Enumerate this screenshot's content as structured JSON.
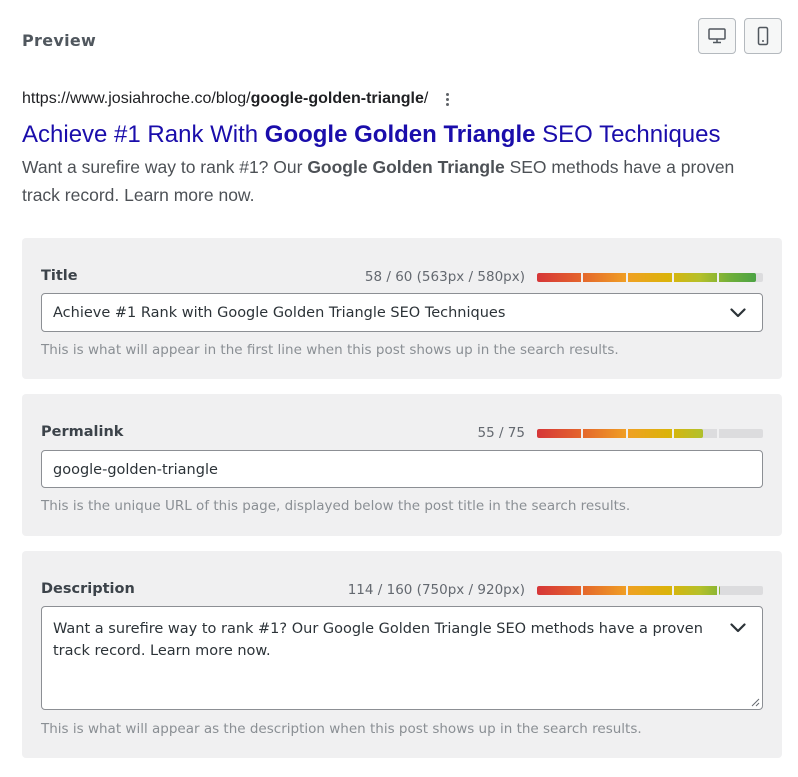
{
  "preview": {
    "heading": "Preview",
    "desktop_icon": "desktop-icon",
    "mobile_icon": "mobile-icon"
  },
  "serp": {
    "url_prefix": "https://www.josiahroche.co/blog/",
    "url_slug": "google-golden-triangle",
    "url_suffix": "/",
    "menu_icon": "more-vertical-icon",
    "title_before": "Achieve #1 Rank With ",
    "title_bold": "Google Golden Triangle",
    "title_after": " SEO Techniques",
    "desc_before": "Want a surefire way to rank #1? Our ",
    "desc_bold": "Google Golden Triangle",
    "desc_after": " SEO methods have a proven track record. Learn more now."
  },
  "title_field": {
    "label": "Title",
    "counter": "58 / 60 (563px / 580px)",
    "progress": 0.97,
    "value": "Achieve #1 Rank with Google Golden Triangle SEO Techniques",
    "help": "This is what will appear in the first line when this post shows up in the search results.",
    "dropdown_icon": "chevron-down-icon"
  },
  "permalink_field": {
    "label": "Permalink",
    "counter": "55 / 75",
    "progress": 0.733,
    "value": "google-golden-triangle",
    "help": "This is the unique URL of this page, displayed below the post title in the search results."
  },
  "description_field": {
    "label": "Description",
    "counter": "114 / 160 (750px / 920px)",
    "progress": 0.81,
    "value": "Want a surefire way to rank #1? Our Google Golden Triangle SEO methods have a proven track record. Learn more now.",
    "help": "This is what will appear as the description when this post shows up in the search results.",
    "dropdown_icon": "chevron-down-icon"
  },
  "colors": {
    "serp_title": "#1a0dab",
    "panel_bg": "#f0f0f1",
    "meter_track": "#dcdcde"
  }
}
